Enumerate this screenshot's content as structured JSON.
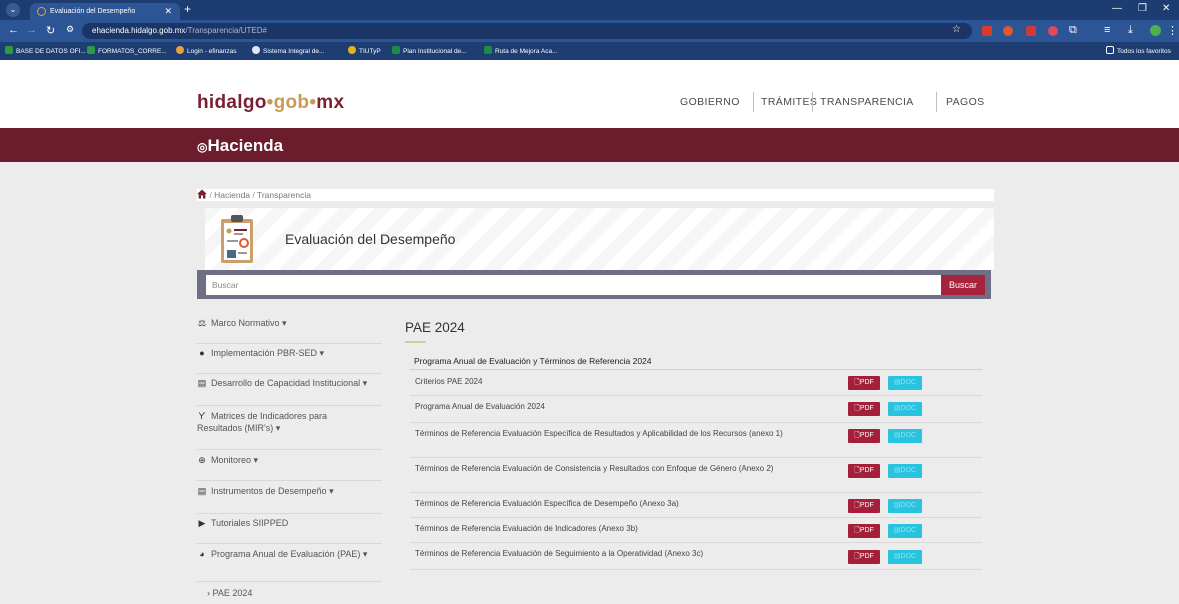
{
  "browser": {
    "tab_title": "Evaluación del Desempeño",
    "url_host": "ehacienda.hidalgo.gob.mx",
    "url_path": "/Transparencia/UTED#",
    "bookmarks": [
      "BASE DE DATOS OFI...",
      "FORMATOS_CORRE...",
      "Login - efinanzas",
      "Sistema Integral de...",
      "TIUTyP",
      "Plan Institucional de...",
      "Ruta de Mejora Aca..."
    ],
    "all_bookmarks": "Todos los favoritos",
    "colors": {
      "tabbar": "#1d3c72",
      "address": "#2c5595"
    }
  },
  "site": {
    "logo_a": "hidalgo",
    "logo_dot1": "•",
    "logo_b": "gob",
    "logo_dot2": "•",
    "logo_c": "mx",
    "nav": [
      "GOBIERNO",
      "TRÁMITES",
      "TRANSPARENCIA",
      "PAGOS"
    ],
    "section_brand": "Hacienda",
    "brand_color": "#6b1d2d"
  },
  "breadcrumb": {
    "home": "Hacienda",
    "current": "Transparencia"
  },
  "banner": {
    "title": "Evaluación del Desempeño"
  },
  "search": {
    "placeholder": "Buscar",
    "button": "Buscar"
  },
  "sidebar": {
    "items": [
      {
        "label": "Marco Normativo ▾",
        "icon": "scale-icon"
      },
      {
        "label": "Implementación PBR-SED ▾",
        "icon": "clock-icon"
      },
      {
        "label": "Desarrollo de Capacidad Institucional ▾",
        "icon": "document-icon"
      },
      {
        "label": "Matrices de Indicadores para Resultados (MIR's) ▾",
        "icon": "sitemap-icon"
      },
      {
        "label": "Monitoreo ▾",
        "icon": "globe-icon"
      },
      {
        "label": "Instrumentos de Desempeño ▾",
        "icon": "document-icon"
      },
      {
        "label": "Tutoriales SIIPPED",
        "icon": "video-icon"
      },
      {
        "label": "Programa Anual de Evaluación (PAE) ▾",
        "icon": "pie-chart-icon"
      }
    ],
    "sub_item": "PAE 2024"
  },
  "main": {
    "title": "PAE 2024",
    "section": "Programa Anual de Evaluación y Términos de Referencia 2024",
    "pdf_label": "PDF",
    "doc_label": "DOC",
    "rows": [
      "Criterios PAE 2024",
      "Programa Anual de Evaluación 2024",
      "Términos de Referencia Evaluación Específica de Resultados y Aplicabilidad de los Recursos (anexo 1)",
      "Términos de Referencia Evaluación de Consistencia y Resultados con Enfoque de Género (Anexo 2)",
      "Términos de Referencia Evaluación Específica de Desempeño (Anexo 3a)",
      "Términos de Referencia Evaluación de Indicadores (Anexo 3b)",
      "Términos de Referencia Evaluación de Seguimiento a la Operatividad (Anexo 3c)"
    ],
    "colors": {
      "pdf": "#a41f3a",
      "doc": "#28c4df"
    }
  }
}
